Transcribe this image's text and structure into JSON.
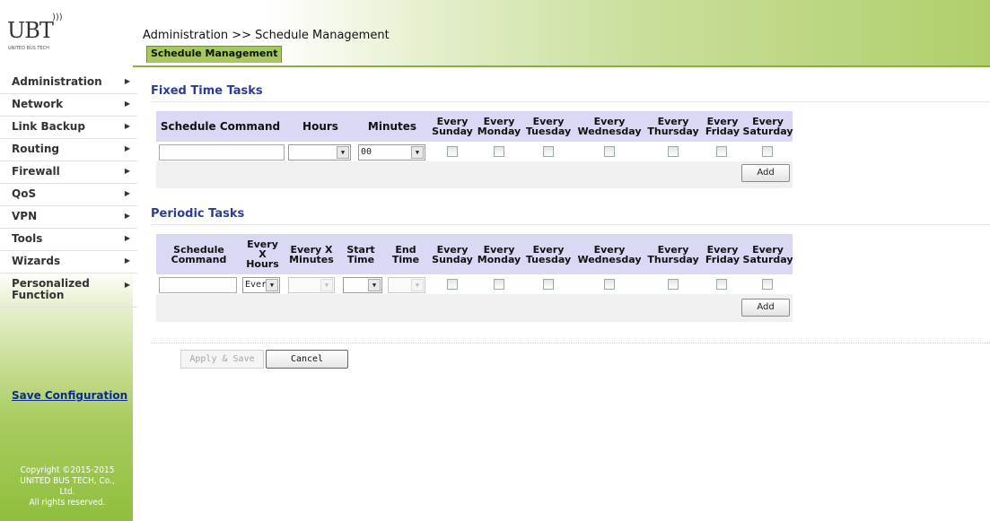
{
  "logo": {
    "mark": "UBT",
    "subtext": "UNITED BUS TECH"
  },
  "sidebar": {
    "items": [
      {
        "label": "Administration"
      },
      {
        "label": "Network"
      },
      {
        "label": "Link Backup"
      },
      {
        "label": "Routing"
      },
      {
        "label": "Firewall"
      },
      {
        "label": "QoS"
      },
      {
        "label": "VPN"
      },
      {
        "label": "Tools"
      },
      {
        "label": "Wizards"
      },
      {
        "label": "Personalized Function"
      }
    ],
    "arrow": "▶",
    "save_configuration": "Save Configuration",
    "copyright": [
      "Copyright ©2015-2015",
      "UNITED BUS TECH, Co.,",
      "Ltd.",
      "All rights reserved."
    ]
  },
  "header": {
    "breadcrumb": "Administration >> Schedule Management",
    "tab": "Schedule Management"
  },
  "fixed": {
    "title": "Fixed Time Tasks",
    "columns": [
      "Schedule Command",
      "Hours",
      "Minutes",
      "Every Sunday",
      "Every Monday",
      "Every Tuesday",
      "Every Wednesday",
      "Every Thursday",
      "Every Friday",
      "Every Saturday"
    ],
    "schedule_command_value": "",
    "hours_value": "",
    "minutes_value": "00",
    "add_label": "Add"
  },
  "periodic": {
    "title": "Periodic Tasks",
    "columns": [
      "Schedule Command",
      "Every X Hours",
      "Every X Minutes",
      "Start Time",
      "End Time",
      "Every Sunday",
      "Every Monday",
      "Every Tuesday",
      "Every Wednesday",
      "Every Thursday",
      "Every Friday",
      "Every Saturday"
    ],
    "schedule_command_value": "",
    "every_x_hours_value": "Ever",
    "every_x_minutes_value": "",
    "start_time_value": "",
    "end_time_value": "",
    "add_label": "Add"
  },
  "actions": {
    "apply_save": "Apply & Save",
    "cancel": "Cancel"
  },
  "colors": {
    "accent_green": "#a6c95b",
    "header_table": "#d9d9f6",
    "section_title": "#2a3d92",
    "link_blue": "#0b2c8a"
  }
}
